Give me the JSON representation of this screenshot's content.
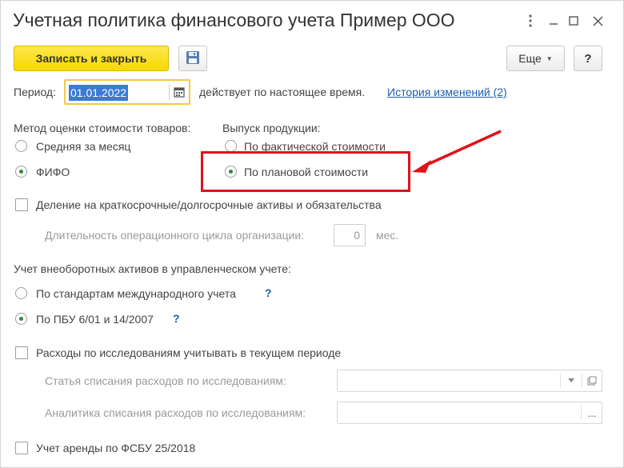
{
  "window": {
    "title": "Учетная политика финансового учета Пример ООО",
    "controls": {
      "more": "⋮",
      "minimize": "—",
      "maximize": "☐",
      "close": "×"
    }
  },
  "toolbar": {
    "save_close_label": "Записать и закрыть",
    "save_icon": "floppy-disk-icon",
    "more_label": "Еще",
    "help_label": "?"
  },
  "period": {
    "label": "Период:",
    "value": "01.01.2022",
    "calendar_icon": "calendar-icon",
    "valid_text": "действует по настоящее время.",
    "history_link": "История изменений (2)"
  },
  "valuation": {
    "label": "Метод оценки стоимости товаров:",
    "options": [
      {
        "label": "Средняя за месяц",
        "checked": false
      },
      {
        "label": "ФИФО",
        "checked": true
      }
    ]
  },
  "production": {
    "label": "Выпуск продукции:",
    "options": [
      {
        "label": "По фактической стоимости",
        "checked": false
      },
      {
        "label": "По плановой стоимости",
        "checked": true
      }
    ]
  },
  "division": {
    "label": "Деление на краткосрочные/долгосрочные активы и обязательства",
    "checked": false,
    "cycle_label": "Длительность операционного цикла организации:",
    "cycle_value": "0",
    "cycle_unit": "мес."
  },
  "noncurrent": {
    "label": "Учет внеоборотных активов в управленческом учете:",
    "options": [
      {
        "label": "По стандартам международного учета",
        "checked": false,
        "help": "?"
      },
      {
        "label": "По ПБУ 6/01 и 14/2007",
        "checked": true,
        "help": "?"
      }
    ]
  },
  "research": {
    "label": "Расходы по исследованиям учитывать в текущем периоде",
    "checked": false,
    "article_label": "Статья списания расходов по исследованиям:",
    "article_value": "",
    "analytics_label": "Аналитика списания расходов по исследованиям:",
    "analytics_value": "",
    "select_button": "..."
  },
  "lease": {
    "label": "Учет аренды по ФСБУ 25/2018",
    "checked": false
  },
  "annotation": {
    "highlight_color": "#e1111a"
  }
}
